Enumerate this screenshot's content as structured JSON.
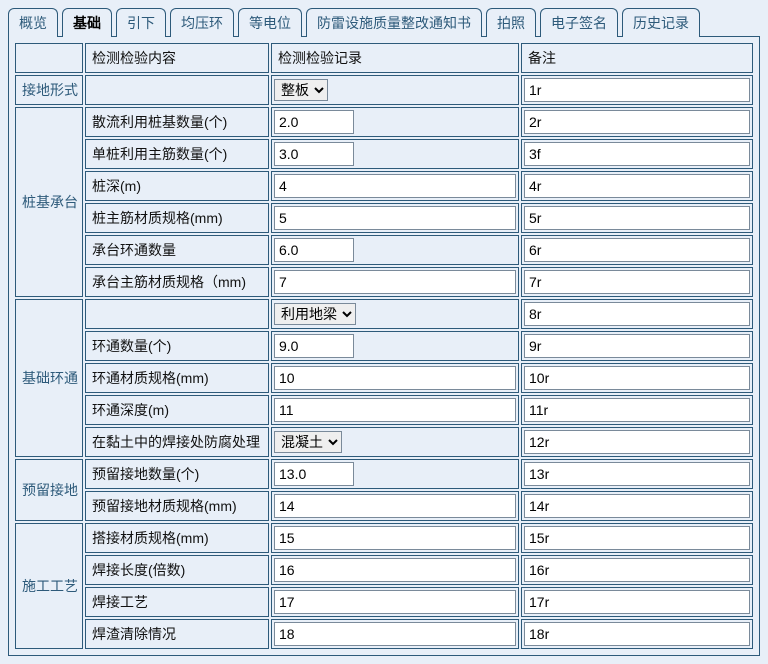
{
  "tabs": [
    {
      "id": "overview",
      "label": "概览"
    },
    {
      "id": "basic",
      "label": "基础"
    },
    {
      "id": "yinxia",
      "label": "引下"
    },
    {
      "id": "junyahuan",
      "label": "均压环"
    },
    {
      "id": "dengdianwei",
      "label": "等电位"
    },
    {
      "id": "rectify",
      "label": "防雷设施质量整改通知书"
    },
    {
      "id": "photo",
      "label": "拍照"
    },
    {
      "id": "sign",
      "label": "电子签名"
    },
    {
      "id": "history",
      "label": "历史记录"
    }
  ],
  "activeTab": "basic",
  "header": {
    "content": "检测检验内容",
    "record": "检测检验记录",
    "remark": "备注"
  },
  "sections": {
    "grounding": {
      "title": "接地形式"
    },
    "pile": {
      "title": "桩基承台"
    },
    "ring": {
      "title": "基础环通"
    },
    "reserve": {
      "title": "预留接地"
    },
    "process": {
      "title": "施工工艺"
    }
  },
  "rows": {
    "grounding": {
      "content": "",
      "select": "整板",
      "remark": "1r"
    },
    "pile1": {
      "content": "散流利用桩基数量(个)",
      "value": "2.0",
      "remark": "2r"
    },
    "pile2": {
      "content": "单桩利用主筋数量(个)",
      "value": "3.0",
      "remark": "3f"
    },
    "pile3": {
      "content": "桩深(m)",
      "value": "4",
      "remark": "4r"
    },
    "pile4": {
      "content": "桩主筋材质规格(mm)",
      "value": "5",
      "remark": "5r"
    },
    "pile5": {
      "content": "承台环通数量",
      "value": "6.0",
      "remark": "6r"
    },
    "pile6": {
      "content": "承台主筋材质规格（mm)",
      "value": "7",
      "remark": "7r"
    },
    "ring0": {
      "content": "",
      "select": "利用地梁",
      "remark": "8r"
    },
    "ring1": {
      "content": "环通数量(个)",
      "value": "9.0",
      "remark": "9r"
    },
    "ring2": {
      "content": "环通材质规格(mm)",
      "value": "10",
      "remark": "10r"
    },
    "ring3": {
      "content": "环通深度(m)",
      "value": "11",
      "remark": "11r"
    },
    "ring4": {
      "content": "在黏土中的焊接处防腐处理",
      "select": "混凝土",
      "remark": "12r"
    },
    "res1": {
      "content": "预留接地数量(个)",
      "value": "13.0",
      "remark": "13r"
    },
    "res2": {
      "content": "预留接地材质规格(mm)",
      "value": "14",
      "remark": "14r"
    },
    "proc1": {
      "content": "搭接材质规格(mm)",
      "value": "15",
      "remark": "15r"
    },
    "proc2": {
      "content": "焊接长度(倍数)",
      "value": "16",
      "remark": "16r"
    },
    "proc3": {
      "content": "焊接工艺",
      "value": "17",
      "remark": "17r"
    },
    "proc4": {
      "content": "焊渣清除情况",
      "value": "18",
      "remark": "18r"
    }
  }
}
